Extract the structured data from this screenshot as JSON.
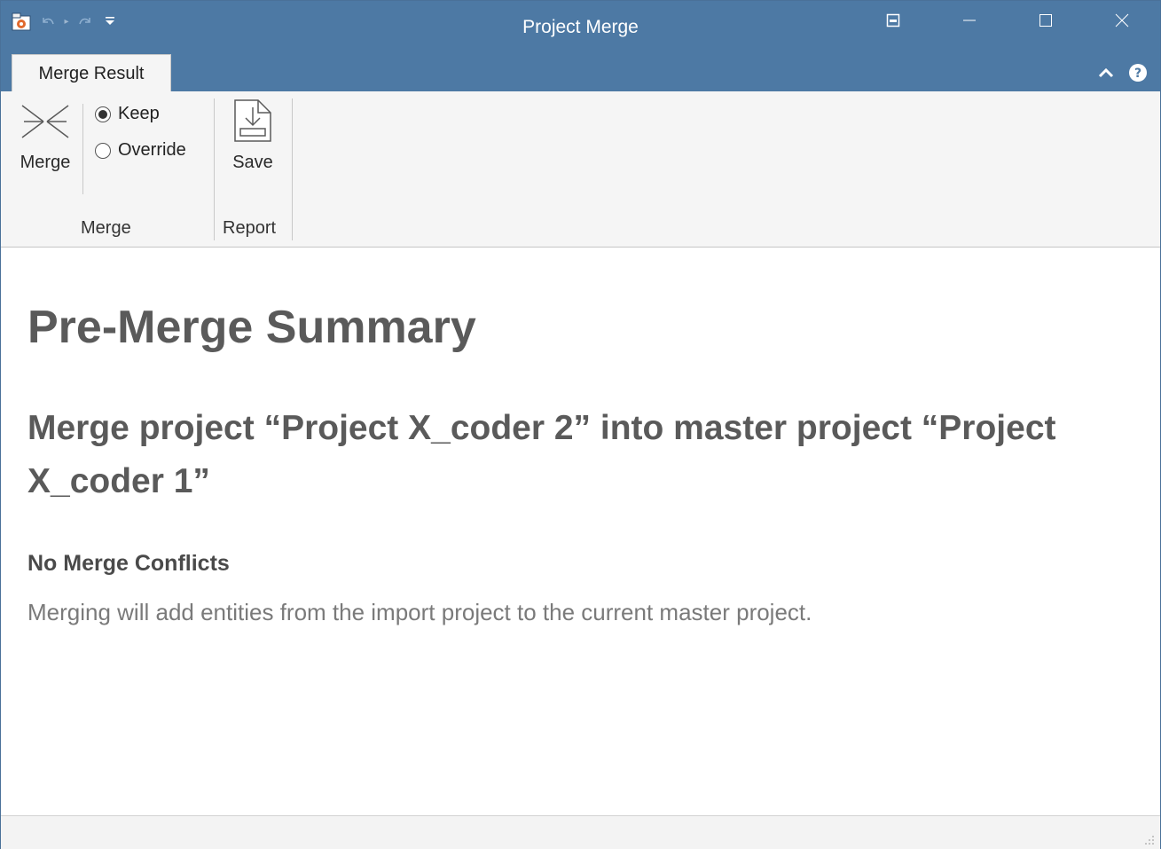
{
  "window": {
    "title": "Project Merge"
  },
  "tabs": [
    {
      "label": "Merge Result",
      "active": true
    }
  ],
  "ribbon": {
    "merge_button_label": "Merge",
    "options": [
      {
        "label": "Keep",
        "selected": true
      },
      {
        "label": "Override",
        "selected": false
      }
    ],
    "save_button_label": "Save",
    "groups": {
      "merge": "Merge",
      "report": "Report"
    }
  },
  "content": {
    "heading": "Pre-Merge Summary",
    "subheading": "Merge project “Project X_coder 2” into master project “Project X_coder 1”",
    "section_title": "No Merge Conflicts",
    "message": "Merging will add entities from the import project to the current master project."
  },
  "colors": {
    "titlebar": "#4d79a4",
    "ribbon_bg": "#f5f5f5",
    "heading_text": "#5a5a5a"
  },
  "icons": {
    "app": "app-icon",
    "undo": "undo-icon",
    "redo": "redo-icon",
    "customize": "customize-qat-icon",
    "merge": "merge-arrows-icon",
    "save": "save-report-icon",
    "help": "help-icon",
    "collapse": "collapse-ribbon-icon"
  }
}
